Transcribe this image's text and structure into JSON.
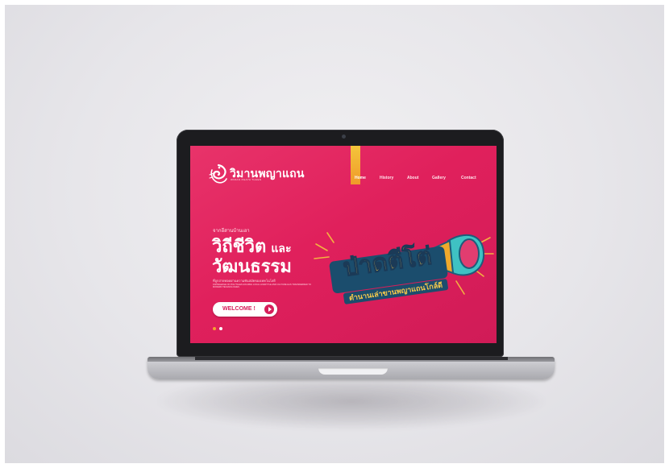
{
  "site": {
    "logo_title": "วิมานพญาแถน",
    "logo_subtitle": "WIMAN PHAYA THAEN"
  },
  "nav": {
    "items": [
      {
        "label": "Home",
        "active": true
      },
      {
        "label": "History",
        "active": false
      },
      {
        "label": "About",
        "active": false
      },
      {
        "label": "Gallery",
        "active": false
      },
      {
        "label": "Contact",
        "active": false
      }
    ]
  },
  "hero": {
    "eyebrow": "จากอีสานบ้านเฮา",
    "headline_line1": "วิถีชีวิต",
    "headline_line1_suffix": "และ",
    "headline_line2": "วัฒนธรรม",
    "tagline_th": "ที่ถูกถ่ายทอดผ่านความทันสมัยของเทคโนโลยี",
    "tagline_en": "KNOWLEDGE OF POLYTALES HOLDING LOCAL LIFESTYLE AND CULTURE HAS TRANSFERRED TO MODERN TECHNOLOGIES",
    "cta_label": "WELCOME !",
    "art_title": "ป่าดตีโต่",
    "art_subtitle": "ตำนานเล่าขานพญาแถนโกล์ดี",
    "slider_count": 2,
    "slider_active": 1
  },
  "colors": {
    "primary": "#e0205c",
    "accent": "#f4c53b",
    "text": "#ffffff"
  }
}
